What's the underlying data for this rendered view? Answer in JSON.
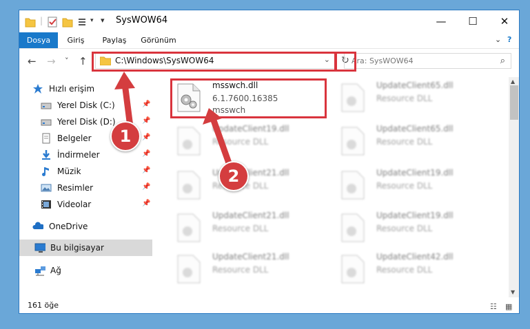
{
  "window": {
    "title": "SysWOW64",
    "controls": {
      "minimize": "—",
      "maximize": "☐",
      "close": "✕"
    }
  },
  "ribbon": {
    "tabs": [
      "Dosya",
      "Giriş",
      "Paylaş",
      "Görünüm"
    ],
    "active_tab": "Dosya",
    "expand_glyph": "⌄",
    "help_glyph": "?"
  },
  "nav": {
    "back": "←",
    "forward": "→",
    "recent": "˅",
    "up": "↑",
    "address": "C:\\Windows\\SysWOW64",
    "address_drop": "⌄",
    "refresh": "↻",
    "search_placeholder": "Ara: SysWOW64",
    "search_glyph": "⌕"
  },
  "sidebar": {
    "items": [
      {
        "label": "Hızlı erişim",
        "icon": "star-icon",
        "pinned": false,
        "selected": false
      },
      {
        "label": "Yerel Disk (C:)",
        "icon": "drive-icon",
        "pinned": true,
        "selected": false
      },
      {
        "label": "Yerel Disk (D:)",
        "icon": "drive-icon",
        "pinned": true,
        "selected": false
      },
      {
        "label": "Belgeler",
        "icon": "documents-icon",
        "pinned": true,
        "selected": false
      },
      {
        "label": "İndirmeler",
        "icon": "download-icon",
        "pinned": true,
        "selected": false
      },
      {
        "label": "Müzik",
        "icon": "music-icon",
        "pinned": true,
        "selected": false
      },
      {
        "label": "Resimler",
        "icon": "pictures-icon",
        "pinned": true,
        "selected": false
      },
      {
        "label": "Videolar",
        "icon": "videos-icon",
        "pinned": true,
        "selected": false
      },
      {
        "label": "OneDrive",
        "icon": "onedrive-icon",
        "pinned": false,
        "selected": false
      },
      {
        "label": "Bu bilgisayar",
        "icon": "computer-icon",
        "pinned": false,
        "selected": true
      },
      {
        "label": "Ağ",
        "icon": "network-icon",
        "pinned": false,
        "selected": false
      }
    ],
    "pin_glyph": "📌"
  },
  "files": {
    "highlighted": {
      "name": "msswch.dll",
      "version": "6.1.7600.16385",
      "description": "msswch"
    },
    "left_column": [
      {
        "name": "UpdateClient19.dll",
        "type": "Resource DLL"
      },
      {
        "name": "UpdateClient21.dll",
        "type": "Resource DLL"
      },
      {
        "name": "UpdateClient21.dll",
        "type": "Resource DLL"
      },
      {
        "name": "UpdateClient21.dll",
        "type": "Resource DLL"
      }
    ],
    "right_column": [
      {
        "name": "UpdateClient65.dll",
        "type": "Resource DLL"
      },
      {
        "name": "UpdateClient65.dll",
        "type": "Resource DLL"
      },
      {
        "name": "UpdateClient19.dll",
        "type": "Resource DLL"
      },
      {
        "name": "UpdateClient19.dll",
        "type": "Resource DLL"
      },
      {
        "name": "UpdateClient42.dll",
        "type": "Resource DLL"
      }
    ]
  },
  "status": {
    "count": "161 öğe"
  },
  "callouts": {
    "step1": "1",
    "step2": "2"
  },
  "colors": {
    "accent": "#1979ca",
    "highlight": "#d9343d",
    "badge": "#d43d3f",
    "desktop": "#6aa7d8"
  }
}
